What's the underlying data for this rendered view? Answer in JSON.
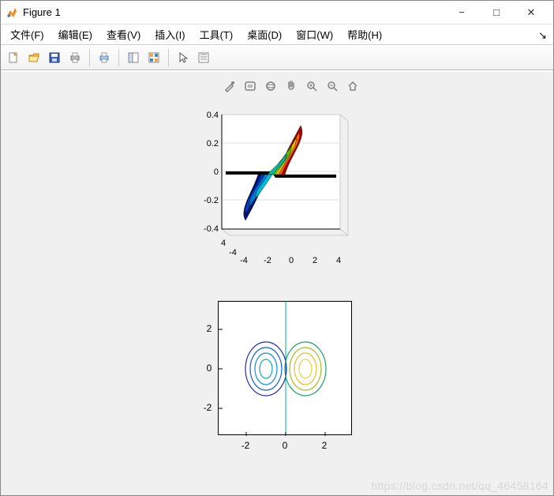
{
  "window": {
    "title": "Figure 1",
    "controls": {
      "min": "−",
      "max": "□",
      "close": "✕"
    }
  },
  "menu": {
    "items": [
      "文件(F)",
      "编辑(E)",
      "查看(V)",
      "插入(I)",
      "工具(T)",
      "桌面(D)",
      "窗口(W)",
      "帮助(H)"
    ],
    "dock_arrow": "↘"
  },
  "toolbar": {
    "icons": [
      "new-file",
      "open-file",
      "save",
      "print",
      "print-figure",
      "link",
      "insert-colorbar",
      "pointer",
      "data-cursor"
    ]
  },
  "figure_toolbar": {
    "icons": [
      "brush",
      "note",
      "rotate3d",
      "pan",
      "zoom-in",
      "zoom-out",
      "home"
    ]
  },
  "watermark": "https://blog.csdn.net/qq_46458164",
  "chart_data": [
    {
      "type": "surface",
      "title": "",
      "xlabel": "",
      "ylabel": "",
      "zlabel": "",
      "xlim": [
        -4,
        4
      ],
      "ylim": [
        -4,
        4
      ],
      "zlim": [
        -0.4,
        0.4
      ],
      "x_ticks": [
        -4,
        -2,
        0,
        2,
        4
      ],
      "y_ticks": [
        -4,
        4
      ],
      "z_ticks": [
        -0.4,
        -0.2,
        0,
        0.2,
        0.4
      ],
      "description": "3D mesh surface, antisymmetric about x=0: positive rainbow-colored peak (~0.4) near (x≈1,y≈0), negative trough (~-0.4) near (x≈-1,y≈0); flat elsewhere approaching 0.",
      "colormap": "jet"
    },
    {
      "type": "contour",
      "title": "",
      "xlabel": "",
      "ylabel": "",
      "xlim": [
        -3,
        3
      ],
      "ylim": [
        -3,
        3
      ],
      "x_ticks": [
        -2,
        0,
        2
      ],
      "y_ticks": [
        -2,
        0,
        2
      ],
      "description": "Contour of same function: concentric oval contours around (-1,0) (negative, blue) and (1,0) (positive, yellow/orange), vertical cyan zero line at x=0.",
      "levels_approx": [
        -0.3,
        -0.2,
        -0.1,
        0,
        0.1,
        0.2,
        0.3
      ],
      "colormap": "parula"
    }
  ]
}
